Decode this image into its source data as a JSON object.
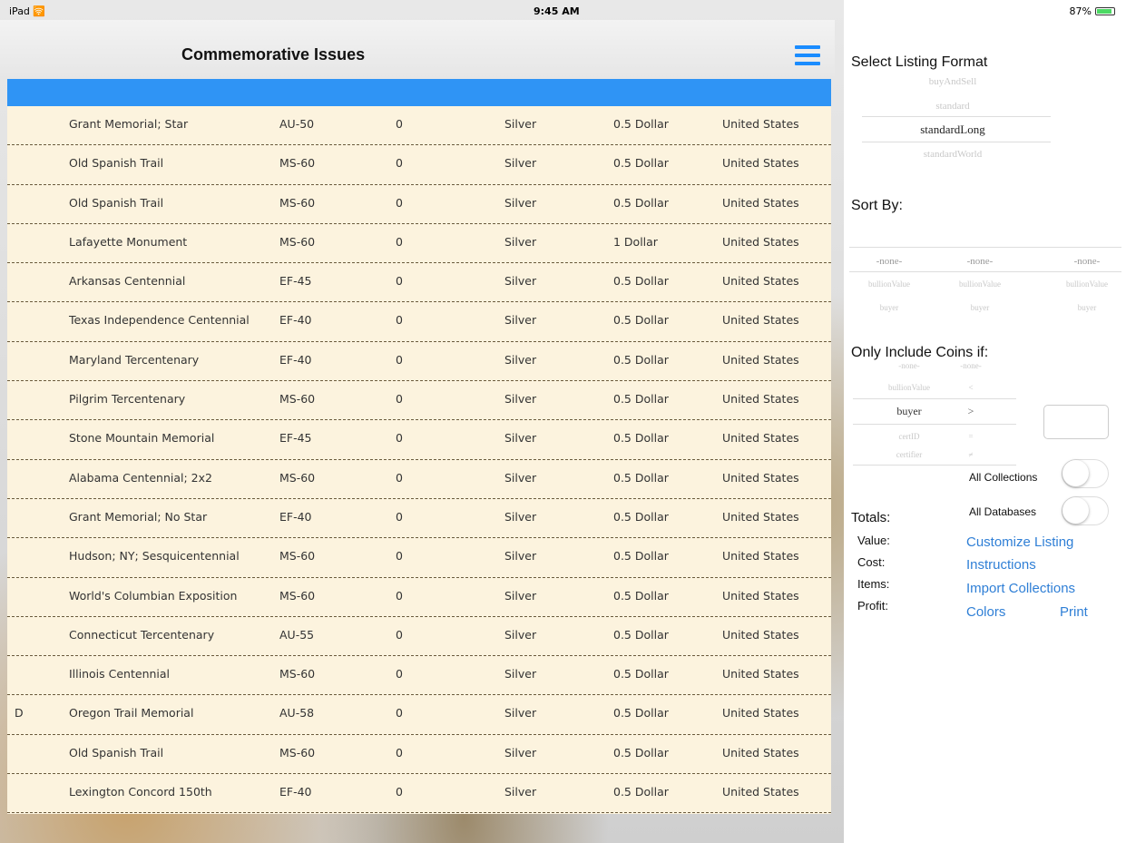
{
  "status_bar": {
    "device": "iPad",
    "time": "9:45 AM",
    "battery": "87%"
  },
  "nav": {
    "title": "Commemorative Issues",
    "menu_icon": "hamburger-menu-icon"
  },
  "rows": [
    {
      "flag": "",
      "name": "Grant Memorial; Star",
      "grade": "AU-50",
      "qty": "0",
      "metal": "Silver",
      "denom": "0.5 Dollar",
      "country": "United States"
    },
    {
      "flag": "",
      "name": "Old Spanish Trail",
      "grade": "MS-60",
      "qty": "0",
      "metal": "Silver",
      "denom": "0.5 Dollar",
      "country": "United States"
    },
    {
      "flag": "",
      "name": "Old Spanish Trail",
      "grade": "MS-60",
      "qty": "0",
      "metal": "Silver",
      "denom": "0.5 Dollar",
      "country": "United States"
    },
    {
      "flag": "",
      "name": "Lafayette Monument",
      "grade": "MS-60",
      "qty": "0",
      "metal": "Silver",
      "denom": "1 Dollar",
      "country": "United States"
    },
    {
      "flag": "",
      "name": "Arkansas Centennial",
      "grade": "EF-45",
      "qty": "0",
      "metal": "Silver",
      "denom": "0.5 Dollar",
      "country": "United States"
    },
    {
      "flag": "",
      "name": "Texas Independence Centennial",
      "grade": "EF-40",
      "qty": "0",
      "metal": "Silver",
      "denom": "0.5 Dollar",
      "country": "United States"
    },
    {
      "flag": "",
      "name": "Maryland Tercentenary",
      "grade": "EF-40",
      "qty": "0",
      "metal": "Silver",
      "denom": "0.5 Dollar",
      "country": "United States"
    },
    {
      "flag": "",
      "name": "Pilgrim Tercentenary",
      "grade": "MS-60",
      "qty": "0",
      "metal": "Silver",
      "denom": "0.5 Dollar",
      "country": "United States"
    },
    {
      "flag": "",
      "name": "Stone Mountain Memorial",
      "grade": "EF-45",
      "qty": "0",
      "metal": "Silver",
      "denom": "0.5 Dollar",
      "country": "United States"
    },
    {
      "flag": "",
      "name": "Alabama Centennial; 2x2",
      "grade": "MS-60",
      "qty": "0",
      "metal": "Silver",
      "denom": "0.5 Dollar",
      "country": "United States"
    },
    {
      "flag": "",
      "name": "Grant Memorial; No Star",
      "grade": "EF-40",
      "qty": "0",
      "metal": "Silver",
      "denom": "0.5 Dollar",
      "country": "United States"
    },
    {
      "flag": "",
      "name": "Hudson; NY; Sesquicentennial",
      "grade": "MS-60",
      "qty": "0",
      "metal": "Silver",
      "denom": "0.5 Dollar",
      "country": "United States"
    },
    {
      "flag": "",
      "name": "World's Columbian Exposition",
      "grade": "MS-60",
      "qty": "0",
      "metal": "Silver",
      "denom": "0.5 Dollar",
      "country": "United States"
    },
    {
      "flag": "",
      "name": "Connecticut Tercentenary",
      "grade": "AU-55",
      "qty": "0",
      "metal": "Silver",
      "denom": "0.5 Dollar",
      "country": "United States"
    },
    {
      "flag": "",
      "name": "Illinois Centennial",
      "grade": "MS-60",
      "qty": "0",
      "metal": "Silver",
      "denom": "0.5 Dollar",
      "country": "United States"
    },
    {
      "flag": "D",
      "name": "Oregon Trail Memorial",
      "grade": "AU-58",
      "qty": "0",
      "metal": "Silver",
      "denom": "0.5 Dollar",
      "country": "United States"
    },
    {
      "flag": "",
      "name": "Old Spanish Trail",
      "grade": "MS-60",
      "qty": "0",
      "metal": "Silver",
      "denom": "0.5 Dollar",
      "country": "United States"
    },
    {
      "flag": "",
      "name": "Lexington Concord 150th",
      "grade": "EF-40",
      "qty": "0",
      "metal": "Silver",
      "denom": "0.5 Dollar",
      "country": "United States"
    }
  ],
  "right": {
    "listing_heading": "Select Listing Format",
    "listing_options": [
      "buyAndSell",
      "standard",
      "standardLong",
      "standardWorld"
    ],
    "listing_selected": "standardLong",
    "sort_heading": "Sort By:",
    "sort_columns": [
      {
        "selected": "-none-",
        "options": [
          "bullionValue",
          "buyer"
        ]
      },
      {
        "selected": "-none-",
        "options": [
          "bullionValue",
          "buyer"
        ]
      },
      {
        "selected": "-none-",
        "options": [
          "bullionValue",
          "buyer"
        ]
      }
    ],
    "include_heading": "Only Include Coins if:",
    "include_fields": [
      "-none-",
      "bullionValue",
      "buyer",
      "certID",
      "certifier"
    ],
    "include_field_selected": "buyer",
    "include_ops": [
      "-none-",
      "<",
      ">",
      "=",
      "≠"
    ],
    "include_op_selected": ">",
    "include_value": "",
    "all_collections_label": "All Collections",
    "all_databases_label": "All Databases",
    "totals_heading": "Totals:",
    "totals_labels": [
      "Value:",
      "Cost:",
      "Items:",
      "Profit:"
    ],
    "links": {
      "customize": "Customize Listing",
      "instructions": "Instructions",
      "import": "Import Collections",
      "colors": "Colors",
      "print": "Print"
    }
  },
  "colors": {
    "accent_blue": "#2f94f5",
    "link_blue": "#2f7fd6",
    "row_bg": "#fcf3de"
  }
}
